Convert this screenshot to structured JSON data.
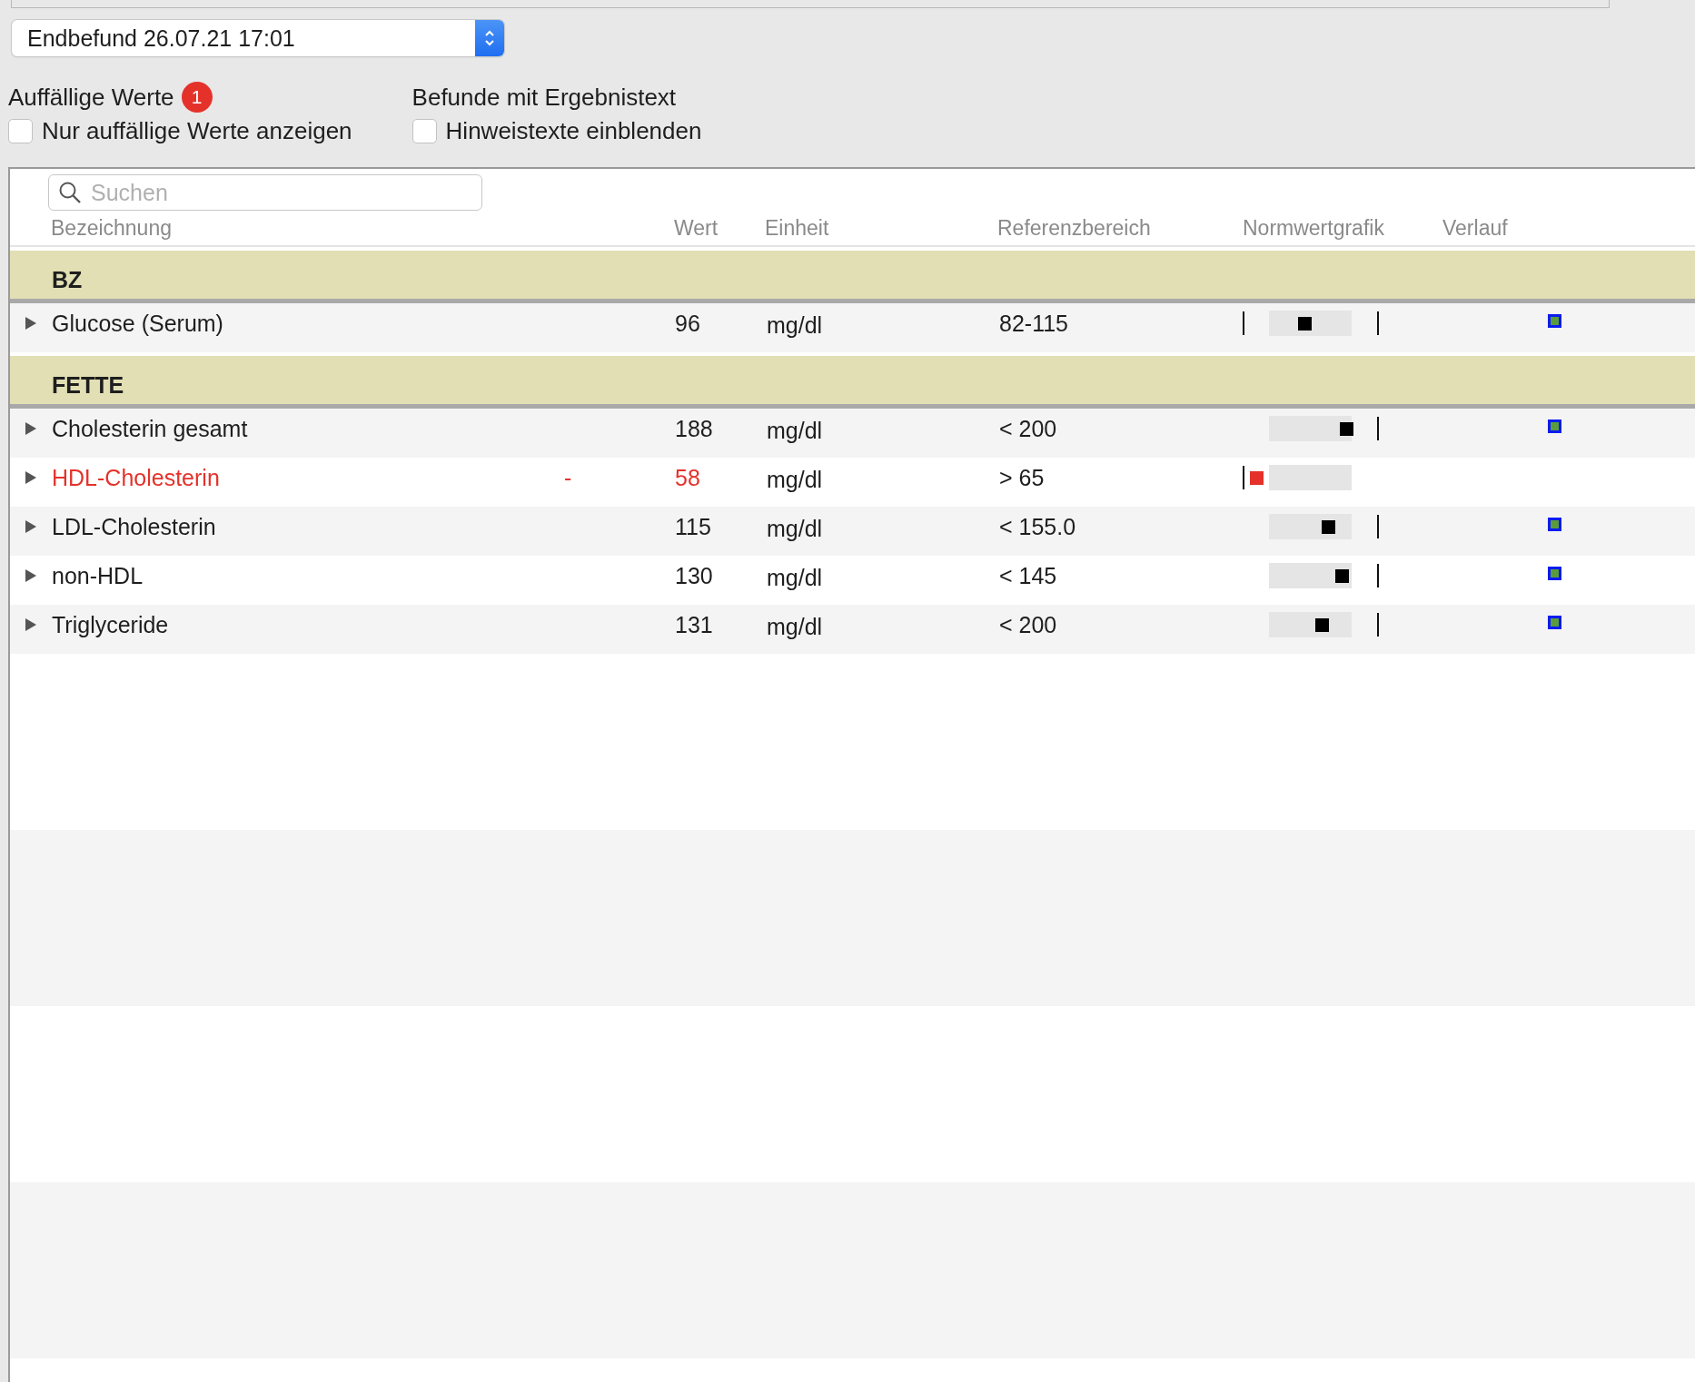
{
  "report_select": {
    "value": "Endbefund 26.07.21 17:01"
  },
  "abnormal": {
    "label": "Auffällige Werte",
    "count": "1",
    "checkbox": {
      "label": "Nur auffällige Werte anzeigen",
      "checked": false
    }
  },
  "result_text": {
    "label": "Befunde mit Ergebnistext",
    "checkbox": {
      "label": "Hinweistexte einblenden",
      "checked": false
    }
  },
  "search": {
    "placeholder": "Suchen"
  },
  "table": {
    "columns": [
      "Bezeichnung",
      "Wert",
      "Einheit",
      "Referenzbereich",
      "Normwertgrafik",
      "Verlauf"
    ],
    "groups": [
      {
        "title": "BZ",
        "rows": [
          {
            "name": "Glucose (Serum)",
            "abnormal": false,
            "value": "96",
            "unit": "mg/dl",
            "reference": "82-115",
            "level": 0.46,
            "lower_mark": true,
            "upper_mark": true,
            "trend": true
          }
        ]
      },
      {
        "title": "FETTE",
        "rows": [
          {
            "name": "Cholesterin gesamt",
            "abnormal": false,
            "value": "188",
            "unit": "mg/dl",
            "reference": "< 200",
            "level": 0.77,
            "lower_mark": false,
            "upper_mark": true,
            "trend": true
          },
          {
            "name": "HDL-Cholesterin",
            "abnormal": true,
            "flag": "-",
            "value": "58",
            "unit": "mg/dl",
            "reference": "> 65",
            "level": 0.11,
            "lower_mark": true,
            "upper_mark": false,
            "trend": false
          },
          {
            "name": "LDL-Cholesterin",
            "abnormal": false,
            "value": "115",
            "unit": "mg/dl",
            "reference": "< 155.0",
            "level": 0.64,
            "lower_mark": false,
            "upper_mark": true,
            "trend": true
          },
          {
            "name": "non-HDL",
            "abnormal": false,
            "value": "130",
            "unit": "mg/dl",
            "reference": "< 145",
            "level": 0.74,
            "lower_mark": false,
            "upper_mark": true,
            "trend": true
          },
          {
            "name": "Triglyceride",
            "abnormal": false,
            "value": "131",
            "unit": "mg/dl",
            "reference": "< 200",
            "level": 0.59,
            "lower_mark": false,
            "upper_mark": true,
            "trend": true
          }
        ]
      }
    ]
  }
}
